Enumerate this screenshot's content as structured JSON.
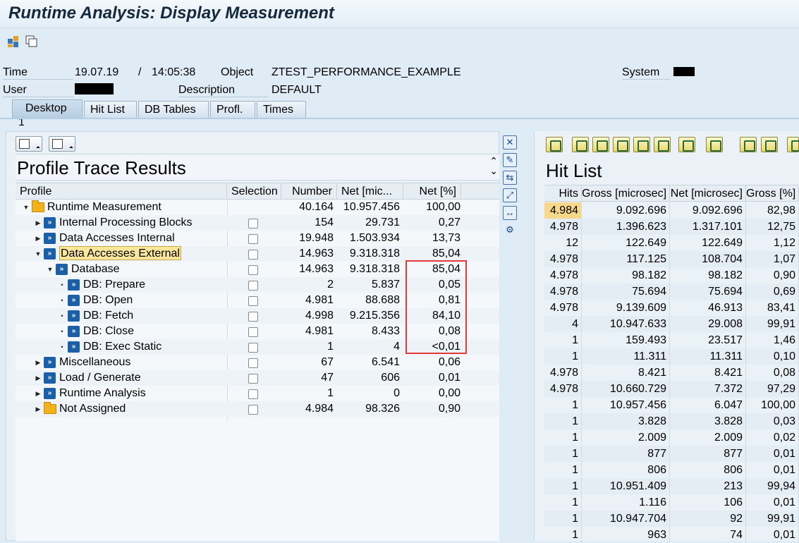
{
  "window": {
    "title": "Runtime Analysis: Display Measurement"
  },
  "header": {
    "time_label": "Time",
    "date": "19.07.19",
    "time_sep": "/",
    "time": "14:05:38",
    "object_label": "Object",
    "object_value": "ZTEST_PERFORMANCE_EXAMPLE",
    "system_label": "System",
    "user_label": "User",
    "description_label": "Description",
    "description_value": "DEFAULT"
  },
  "tabs": [
    {
      "label": "Desktop 1",
      "active": true
    },
    {
      "label": "Hit List"
    },
    {
      "label": "DB Tables"
    },
    {
      "label": "Profl."
    },
    {
      "label": "Times"
    }
  ],
  "profile": {
    "title": "Profile Trace Results",
    "columns": [
      "Profile",
      "Selection",
      "Number",
      "Net [mic...",
      "Net [%]"
    ],
    "rows": [
      {
        "label": "Runtime Measurement",
        "number": "40.164",
        "net": "10.957.456",
        "pct": "100,00"
      },
      {
        "label": "Internal Processing Blocks",
        "number": "154",
        "net": "29.731",
        "pct": "0,27"
      },
      {
        "label": "Data Accesses Internal",
        "number": "19.948",
        "net": "1.503.934",
        "pct": "13,73"
      },
      {
        "label": "Data Accesses External",
        "number": "14.963",
        "net": "9.318.318",
        "pct": "85,04"
      },
      {
        "label": "Database",
        "number": "14.963",
        "net": "9.318.318",
        "pct": "85,04"
      },
      {
        "label": "DB: Prepare",
        "number": "2",
        "net": "5.837",
        "pct": "0,05"
      },
      {
        "label": "DB: Open",
        "number": "4.981",
        "net": "88.688",
        "pct": "0,81"
      },
      {
        "label": "DB: Fetch",
        "number": "4.998",
        "net": "9.215.356",
        "pct": "84,10"
      },
      {
        "label": "DB: Close",
        "number": "4.981",
        "net": "8.433",
        "pct": "0,08"
      },
      {
        "label": "DB: Exec Static",
        "number": "1",
        "net": "4",
        "pct": "<0,01"
      },
      {
        "label": "Miscellaneous",
        "number": "67",
        "net": "6.541",
        "pct": "0,06"
      },
      {
        "label": "Load / Generate",
        "number": "47",
        "net": "606",
        "pct": "0,01"
      },
      {
        "label": "Runtime Analysis",
        "number": "1",
        "net": "0",
        "pct": "0,00"
      },
      {
        "label": "Not Assigned",
        "number": "4.984",
        "net": "98.326",
        "pct": "0,90"
      }
    ]
  },
  "hitlist": {
    "title": "Hit List",
    "columns": [
      "Hits",
      "Gross [microsec]",
      "Net [microsec]",
      "Gross [%]"
    ],
    "rows": [
      [
        "4.984",
        "9.092.696",
        "9.092.696",
        "82,98"
      ],
      [
        "4.978",
        "1.396.623",
        "1.317.101",
        "12,75"
      ],
      [
        "12",
        "122.649",
        "122.649",
        "1,12"
      ],
      [
        "4.978",
        "117.125",
        "108.704",
        "1,07"
      ],
      [
        "4.978",
        "98.182",
        "98.182",
        "0,90"
      ],
      [
        "4.978",
        "75.694",
        "75.694",
        "0,69"
      ],
      [
        "4.978",
        "9.139.609",
        "46.913",
        "83,41"
      ],
      [
        "4",
        "10.947.633",
        "29.008",
        "99,91"
      ],
      [
        "1",
        "159.493",
        "23.517",
        "1,46"
      ],
      [
        "1",
        "11.311",
        "11.311",
        "0,10"
      ],
      [
        "4.978",
        "8.421",
        "8.421",
        "0,08"
      ],
      [
        "4.978",
        "10.660.729",
        "7.372",
        "97,29"
      ],
      [
        "1",
        "10.957.456",
        "6.047",
        "100,00"
      ],
      [
        "1",
        "3.828",
        "3.828",
        "0,03"
      ],
      [
        "1",
        "2.009",
        "2.009",
        "0,02"
      ],
      [
        "1",
        "877",
        "877",
        "0,01"
      ],
      [
        "1",
        "806",
        "806",
        "0,01"
      ],
      [
        "1",
        "10.951.409",
        "213",
        "99,94"
      ],
      [
        "1",
        "1.116",
        "106",
        "0,01"
      ],
      [
        "1",
        "10.947.704",
        "92",
        "99,91"
      ],
      [
        "1",
        "963",
        "74",
        "0,01"
      ]
    ]
  },
  "colors": {
    "highlight": "#f7d88a",
    "annotation": "#e33a3a",
    "object_icon": "#1a5fa8",
    "folder": "#f3b21c"
  },
  "icons": [
    "layout-icon",
    "window-icon",
    "close-icon",
    "new-icon",
    "refresh-icon",
    "fullscreen-icon",
    "resize-icon",
    "tool-icon",
    "folder-icon",
    "program-icon"
  ]
}
